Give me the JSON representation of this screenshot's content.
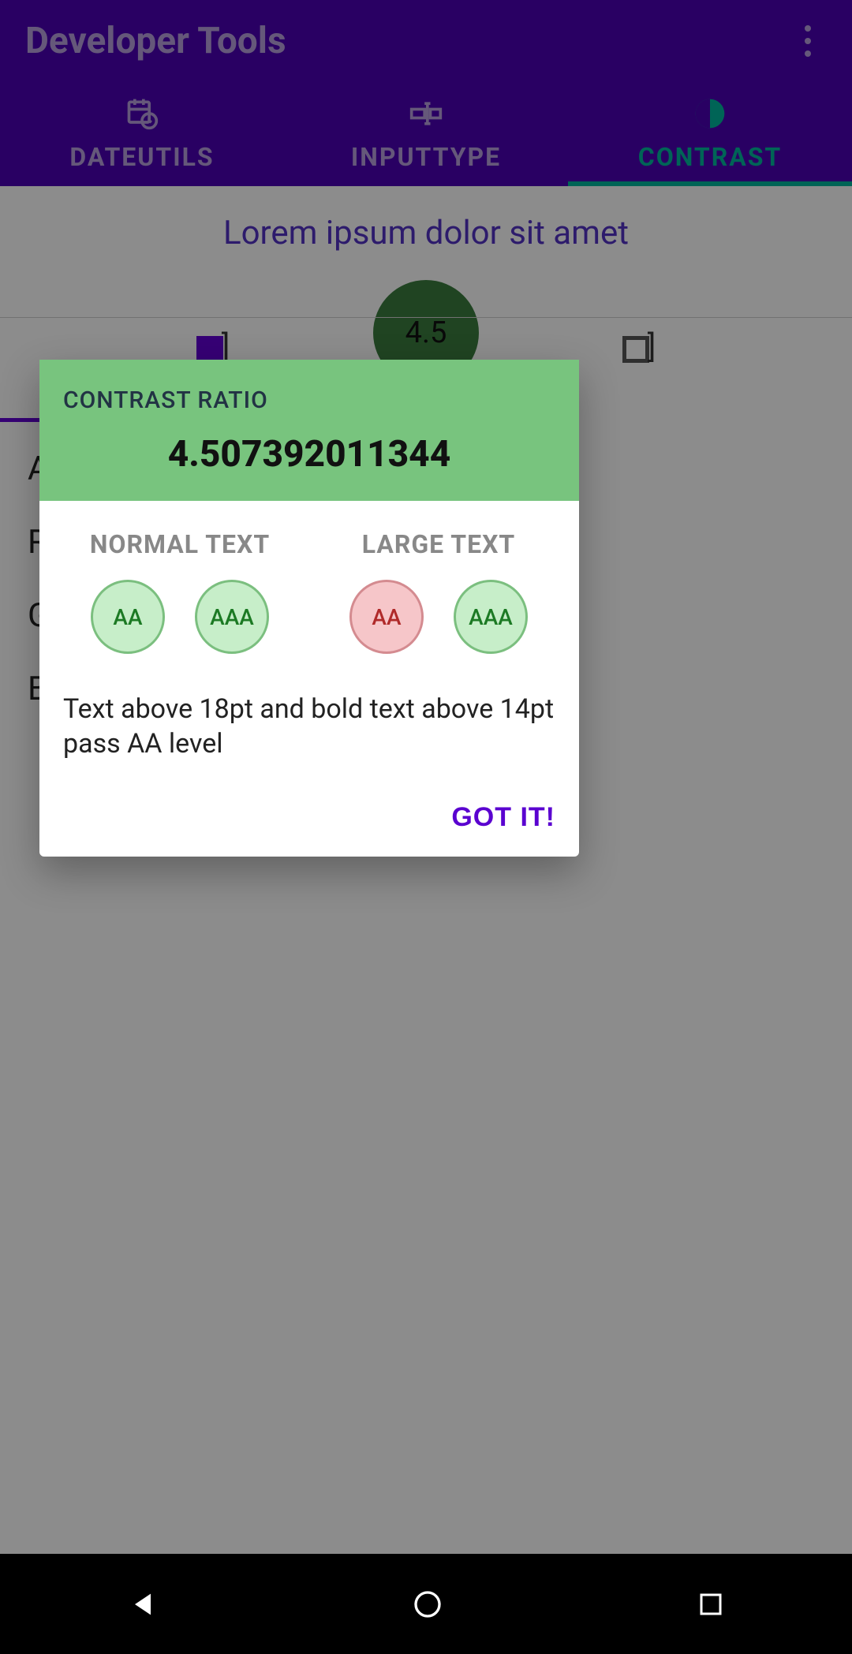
{
  "appbar": {
    "title": "Developer Tools",
    "tabs": [
      {
        "label": "DATEUTILS"
      },
      {
        "label": "INPUTTYPE"
      },
      {
        "label": "CONTRAST"
      }
    ]
  },
  "preview": {
    "sample_text": "Lorem ipsum dolor sit amet",
    "ratio_short": "4.5"
  },
  "background_list": {
    "items": [
      "A",
      "R",
      "G",
      "B"
    ]
  },
  "dialog": {
    "title": "CONTRAST RATIO",
    "ratio_full": "4.507392011344",
    "normal_text_label": "NORMAL TEXT",
    "large_text_label": "LARGE TEXT",
    "badges": {
      "normal": [
        {
          "label": "AA",
          "pass": true
        },
        {
          "label": "AAA",
          "pass": true
        }
      ],
      "large": [
        {
          "label": "AA",
          "pass": false
        },
        {
          "label": "AAA",
          "pass": true
        }
      ]
    },
    "message": "Text above 18pt and bold text above 14pt pass AA level",
    "confirm_label": "GOT IT!"
  }
}
